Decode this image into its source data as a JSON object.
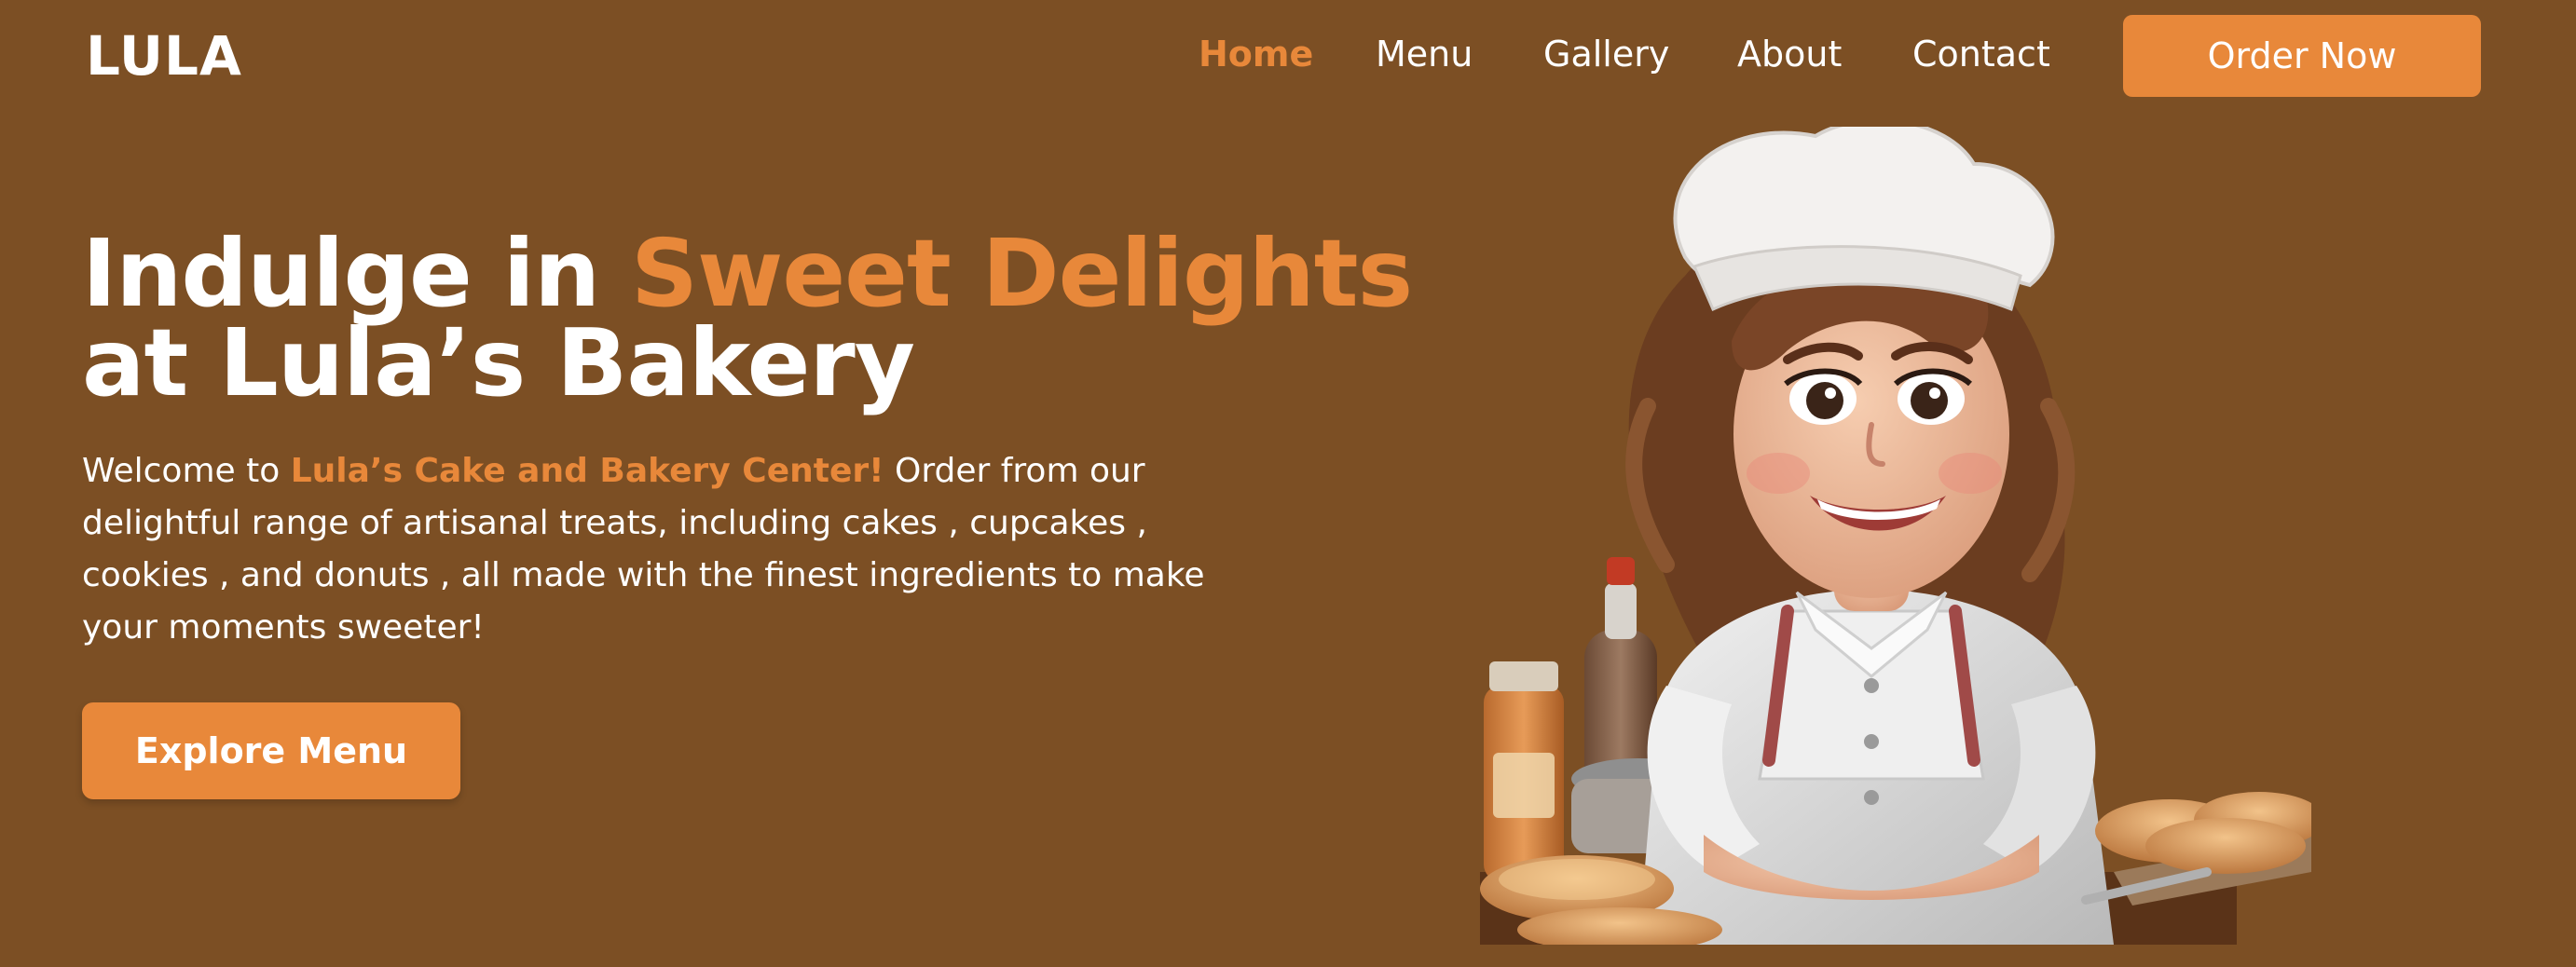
{
  "nav": {
    "logo": "LULA",
    "links": [
      {
        "label": "Home",
        "active": true
      },
      {
        "label": "Menu",
        "active": false
      },
      {
        "label": "Gallery",
        "active": false
      },
      {
        "label": "About",
        "active": false
      },
      {
        "label": "Contact",
        "active": false
      }
    ],
    "cta_label": "Order Now"
  },
  "hero": {
    "title_part1": "Indulge in ",
    "title_accent": "Sweet Delights",
    "title_part2": "at Lula’s Bakery",
    "desc_prefix": "Welcome to ",
    "desc_brand": "Lula’s Cake and Bakery Center!",
    "desc_rest": " Order from our delightful range of artisanal treats, including cakes , cupcakes , cookies , and donuts , all made with the finest ingredients to make your moments sweeter!",
    "button_label": "Explore Menu",
    "image_label": "Lula’s Bakery chef"
  },
  "colors": {
    "background": "#7c4f24",
    "accent": "#e8883a",
    "text": "#ffffff"
  }
}
